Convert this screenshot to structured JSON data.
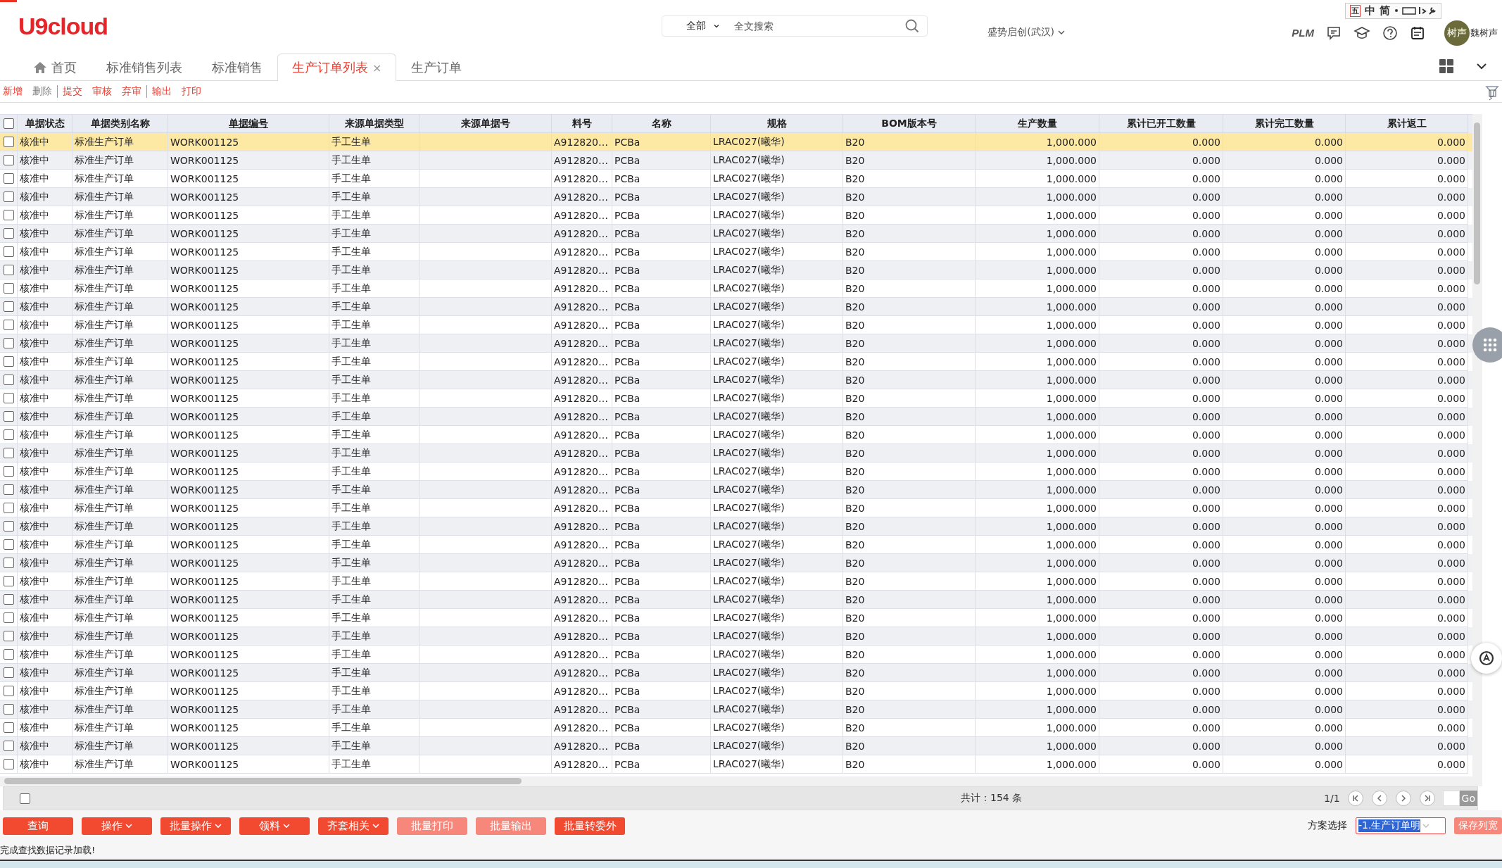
{
  "header": {
    "logo": "U9cloud",
    "search": {
      "scope": "全部",
      "placeholder": "全文搜索"
    },
    "company": "盛势启创(武汉)",
    "ime": [
      "五",
      "中",
      "简"
    ],
    "plm": "PLM",
    "avatar": "树声",
    "user": "魏树声"
  },
  "tabs": [
    {
      "label": "首页",
      "kind": "home",
      "selected": false,
      "closable": false
    },
    {
      "label": "标准销售列表",
      "kind": "page",
      "selected": false,
      "closable": false
    },
    {
      "label": "标准销售",
      "kind": "page",
      "selected": false,
      "closable": false
    },
    {
      "label": "生产订单列表",
      "kind": "page",
      "selected": true,
      "closable": true
    },
    {
      "label": "生产订单",
      "kind": "page",
      "selected": false,
      "closable": false
    }
  ],
  "close_mark": "×",
  "toolbar": [
    {
      "label": "新增",
      "disabled": false,
      "separator_after": false
    },
    {
      "label": "删除",
      "disabled": true,
      "separator_after": true
    },
    {
      "label": "提交",
      "disabled": false,
      "separator_after": false
    },
    {
      "label": "审核",
      "disabled": false,
      "separator_after": false
    },
    {
      "label": "弃审",
      "disabled": false,
      "separator_after": true
    },
    {
      "label": "输出",
      "disabled": false,
      "separator_after": false
    },
    {
      "label": "打印",
      "disabled": false,
      "separator_after": false
    }
  ],
  "table": {
    "select_all_checked": false,
    "columns": [
      {
        "label": "单据状态",
        "underlined": false
      },
      {
        "label": "单据类别名称",
        "underlined": false
      },
      {
        "label": "单据编号",
        "underlined": true
      },
      {
        "label": "来源单据类型",
        "underlined": false
      },
      {
        "label": "来源单据号",
        "underlined": false
      },
      {
        "label": "料号",
        "underlined": false
      },
      {
        "label": "名称",
        "underlined": false
      },
      {
        "label": "规格",
        "underlined": false
      },
      {
        "label": "BOM版本号",
        "underlined": false
      },
      {
        "label": "生产数量",
        "underlined": false
      },
      {
        "label": "累计已开工数量",
        "underlined": false
      },
      {
        "label": "累计完工数量",
        "underlined": false
      },
      {
        "label": "累计返工",
        "underlined": false
      }
    ],
    "rows": [
      {
        "selected": true,
        "checked": false,
        "cells": [
          "核准中",
          "标准生产订单",
          "WORK001125",
          "手工生单",
          null,
          "A912820…",
          "PCBa",
          "LRAC027(曦华)",
          "B20",
          "1,000.000",
          "0.000",
          "0.000",
          "0.000"
        ]
      },
      {
        "selected": false,
        "checked": false,
        "cells": [
          "核准中",
          "标准生产订单",
          "WORK001125",
          "手工生单",
          null,
          "A912820…",
          "PCBa",
          "LRAC027(曦华)",
          "B20",
          "1,000.000",
          "0.000",
          "0.000",
          "0.000"
        ]
      },
      {
        "selected": false,
        "checked": false,
        "cells": [
          "核准中",
          "标准生产订单",
          "WORK001125",
          "手工生单",
          null,
          "A912820…",
          "PCBa",
          "LRAC027(曦华)",
          "B20",
          "1,000.000",
          "0.000",
          "0.000",
          "0.000"
        ]
      },
      {
        "selected": false,
        "checked": false,
        "cells": [
          "核准中",
          "标准生产订单",
          "WORK001125",
          "手工生单",
          null,
          "A912820…",
          "PCBa",
          "LRAC027(曦华)",
          "B20",
          "1,000.000",
          "0.000",
          "0.000",
          "0.000"
        ]
      },
      {
        "selected": false,
        "checked": false,
        "cells": [
          "核准中",
          "标准生产订单",
          "WORK001125",
          "手工生单",
          null,
          "A912820…",
          "PCBa",
          "LRAC027(曦华)",
          "B20",
          "1,000.000",
          "0.000",
          "0.000",
          "0.000"
        ]
      },
      {
        "selected": false,
        "checked": false,
        "cells": [
          "核准中",
          "标准生产订单",
          "WORK001125",
          "手工生单",
          null,
          "A912820…",
          "PCBa",
          "LRAC027(曦华)",
          "B20",
          "1,000.000",
          "0.000",
          "0.000",
          "0.000"
        ]
      },
      {
        "selected": false,
        "checked": false,
        "cells": [
          "核准中",
          "标准生产订单",
          "WORK001125",
          "手工生单",
          null,
          "A912820…",
          "PCBa",
          "LRAC027(曦华)",
          "B20",
          "1,000.000",
          "0.000",
          "0.000",
          "0.000"
        ]
      },
      {
        "selected": false,
        "checked": false,
        "cells": [
          "核准中",
          "标准生产订单",
          "WORK001125",
          "手工生单",
          null,
          "A912820…",
          "PCBa",
          "LRAC027(曦华)",
          "B20",
          "1,000.000",
          "0.000",
          "0.000",
          "0.000"
        ]
      },
      {
        "selected": false,
        "checked": false,
        "cells": [
          "核准中",
          "标准生产订单",
          "WORK001125",
          "手工生单",
          null,
          "A912820…",
          "PCBa",
          "LRAC027(曦华)",
          "B20",
          "1,000.000",
          "0.000",
          "0.000",
          "0.000"
        ]
      },
      {
        "selected": false,
        "checked": false,
        "cells": [
          "核准中",
          "标准生产订单",
          "WORK001125",
          "手工生单",
          null,
          "A912820…",
          "PCBa",
          "LRAC027(曦华)",
          "B20",
          "1,000.000",
          "0.000",
          "0.000",
          "0.000"
        ]
      },
      {
        "selected": false,
        "checked": false,
        "cells": [
          "核准中",
          "标准生产订单",
          "WORK001125",
          "手工生单",
          null,
          "A912820…",
          "PCBa",
          "LRAC027(曦华)",
          "B20",
          "1,000.000",
          "0.000",
          "0.000",
          "0.000"
        ]
      },
      {
        "selected": false,
        "checked": false,
        "cells": [
          "核准中",
          "标准生产订单",
          "WORK001125",
          "手工生单",
          null,
          "A912820…",
          "PCBa",
          "LRAC027(曦华)",
          "B20",
          "1,000.000",
          "0.000",
          "0.000",
          "0.000"
        ]
      },
      {
        "selected": false,
        "checked": false,
        "cells": [
          "核准中",
          "标准生产订单",
          "WORK001125",
          "手工生单",
          null,
          "A912820…",
          "PCBa",
          "LRAC027(曦华)",
          "B20",
          "1,000.000",
          "0.000",
          "0.000",
          "0.000"
        ]
      },
      {
        "selected": false,
        "checked": false,
        "cells": [
          "核准中",
          "标准生产订单",
          "WORK001125",
          "手工生单",
          null,
          "A912820…",
          "PCBa",
          "LRAC027(曦华)",
          "B20",
          "1,000.000",
          "0.000",
          "0.000",
          "0.000"
        ]
      },
      {
        "selected": false,
        "checked": false,
        "cells": [
          "核准中",
          "标准生产订单",
          "WORK001125",
          "手工生单",
          null,
          "A912820…",
          "PCBa",
          "LRAC027(曦华)",
          "B20",
          "1,000.000",
          "0.000",
          "0.000",
          "0.000"
        ]
      },
      {
        "selected": false,
        "checked": false,
        "cells": [
          "核准中",
          "标准生产订单",
          "WORK001125",
          "手工生单",
          null,
          "A912820…",
          "PCBa",
          "LRAC027(曦华)",
          "B20",
          "1,000.000",
          "0.000",
          "0.000",
          "0.000"
        ]
      },
      {
        "selected": false,
        "checked": false,
        "cells": [
          "核准中",
          "标准生产订单",
          "WORK001125",
          "手工生单",
          null,
          "A912820…",
          "PCBa",
          "LRAC027(曦华)",
          "B20",
          "1,000.000",
          "0.000",
          "0.000",
          "0.000"
        ]
      },
      {
        "selected": false,
        "checked": false,
        "cells": [
          "核准中",
          "标准生产订单",
          "WORK001125",
          "手工生单",
          null,
          "A912820…",
          "PCBa",
          "LRAC027(曦华)",
          "B20",
          "1,000.000",
          "0.000",
          "0.000",
          "0.000"
        ]
      },
      {
        "selected": false,
        "checked": false,
        "cells": [
          "核准中",
          "标准生产订单",
          "WORK001125",
          "手工生单",
          null,
          "A912820…",
          "PCBa",
          "LRAC027(曦华)",
          "B20",
          "1,000.000",
          "0.000",
          "0.000",
          "0.000"
        ]
      },
      {
        "selected": false,
        "checked": false,
        "cells": [
          "核准中",
          "标准生产订单",
          "WORK001125",
          "手工生单",
          null,
          "A912820…",
          "PCBa",
          "LRAC027(曦华)",
          "B20",
          "1,000.000",
          "0.000",
          "0.000",
          "0.000"
        ]
      },
      {
        "selected": false,
        "checked": false,
        "cells": [
          "核准中",
          "标准生产订单",
          "WORK001125",
          "手工生单",
          null,
          "A912820…",
          "PCBa",
          "LRAC027(曦华)",
          "B20",
          "1,000.000",
          "0.000",
          "0.000",
          "0.000"
        ]
      },
      {
        "selected": false,
        "checked": false,
        "cells": [
          "核准中",
          "标准生产订单",
          "WORK001125",
          "手工生单",
          null,
          "A912820…",
          "PCBa",
          "LRAC027(曦华)",
          "B20",
          "1,000.000",
          "0.000",
          "0.000",
          "0.000"
        ]
      },
      {
        "selected": false,
        "checked": false,
        "cells": [
          "核准中",
          "标准生产订单",
          "WORK001125",
          "手工生单",
          null,
          "A912820…",
          "PCBa",
          "LRAC027(曦华)",
          "B20",
          "1,000.000",
          "0.000",
          "0.000",
          "0.000"
        ]
      },
      {
        "selected": false,
        "checked": false,
        "cells": [
          "核准中",
          "标准生产订单",
          "WORK001125",
          "手工生单",
          null,
          "A912820…",
          "PCBa",
          "LRAC027(曦华)",
          "B20",
          "1,000.000",
          "0.000",
          "0.000",
          "0.000"
        ]
      },
      {
        "selected": false,
        "checked": false,
        "cells": [
          "核准中",
          "标准生产订单",
          "WORK001125",
          "手工生单",
          null,
          "A912820…",
          "PCBa",
          "LRAC027(曦华)",
          "B20",
          "1,000.000",
          "0.000",
          "0.000",
          "0.000"
        ]
      },
      {
        "selected": false,
        "checked": false,
        "cells": [
          "核准中",
          "标准生产订单",
          "WORK001125",
          "手工生单",
          null,
          "A912820…",
          "PCBa",
          "LRAC027(曦华)",
          "B20",
          "1,000.000",
          "0.000",
          "0.000",
          "0.000"
        ]
      },
      {
        "selected": false,
        "checked": false,
        "cells": [
          "核准中",
          "标准生产订单",
          "WORK001125",
          "手工生单",
          null,
          "A912820…",
          "PCBa",
          "LRAC027(曦华)",
          "B20",
          "1,000.000",
          "0.000",
          "0.000",
          "0.000"
        ]
      },
      {
        "selected": false,
        "checked": false,
        "cells": [
          "核准中",
          "标准生产订单",
          "WORK001125",
          "手工生单",
          null,
          "A912820…",
          "PCBa",
          "LRAC027(曦华)",
          "B20",
          "1,000.000",
          "0.000",
          "0.000",
          "0.000"
        ]
      },
      {
        "selected": false,
        "checked": false,
        "cells": [
          "核准中",
          "标准生产订单",
          "WORK001125",
          "手工生单",
          null,
          "A912820…",
          "PCBa",
          "LRAC027(曦华)",
          "B20",
          "1,000.000",
          "0.000",
          "0.000",
          "0.000"
        ]
      },
      {
        "selected": false,
        "checked": false,
        "cells": [
          "核准中",
          "标准生产订单",
          "WORK001125",
          "手工生单",
          null,
          "A912820…",
          "PCBa",
          "LRAC027(曦华)",
          "B20",
          "1,000.000",
          "0.000",
          "0.000",
          "0.000"
        ]
      },
      {
        "selected": false,
        "checked": false,
        "cells": [
          "核准中",
          "标准生产订单",
          "WORK001125",
          "手工生单",
          null,
          "A912820…",
          "PCBa",
          "LRAC027(曦华)",
          "B20",
          "1,000.000",
          "0.000",
          "0.000",
          "0.000"
        ]
      },
      {
        "selected": false,
        "checked": false,
        "cells": [
          "核准中",
          "标准生产订单",
          "WORK001125",
          "手工生单",
          null,
          "A912820…",
          "PCBa",
          "LRAC027(曦华)",
          "B20",
          "1,000.000",
          "0.000",
          "0.000",
          "0.000"
        ]
      },
      {
        "selected": false,
        "checked": false,
        "cells": [
          "核准中",
          "标准生产订单",
          "WORK001125",
          "手工生单",
          null,
          "A912820…",
          "PCBa",
          "LRAC027(曦华)",
          "B20",
          "1,000.000",
          "0.000",
          "0.000",
          "0.000"
        ]
      },
      {
        "selected": false,
        "checked": false,
        "cells": [
          "核准中",
          "标准生产订单",
          "WORK001125",
          "手工生单",
          null,
          "A912820…",
          "PCBa",
          "LRAC027(曦华)",
          "B20",
          "1,000.000",
          "0.000",
          "0.000",
          "0.000"
        ]
      },
      {
        "selected": false,
        "checked": false,
        "cells": [
          "核准中",
          "标准生产订单",
          "WORK001125",
          "手工生单",
          null,
          "A912820…",
          "PCBa",
          "LRAC027(曦华)",
          "B20",
          "1,000.000",
          "0.000",
          "0.000",
          "0.000"
        ]
      }
    ]
  },
  "footer": {
    "select_all_checked": false,
    "total": "共计：154 条",
    "page": "1/1",
    "go": "Go"
  },
  "actions": [
    {
      "label": "查询",
      "dropdown": false,
      "disabled": false
    },
    {
      "label": "操作",
      "dropdown": true,
      "disabled": false
    },
    {
      "label": "批量操作",
      "dropdown": true,
      "disabled": false
    },
    {
      "label": "领料",
      "dropdown": true,
      "disabled": false
    },
    {
      "label": "齐套相关",
      "dropdown": true,
      "disabled": false
    },
    {
      "label": "批量打印",
      "dropdown": false,
      "disabled": true
    },
    {
      "label": "批量输出",
      "dropdown": false,
      "disabled": true
    },
    {
      "label": "批量转委外",
      "dropdown": false,
      "disabled": false
    }
  ],
  "scheme": {
    "label": "方案选择",
    "value": "-1.生产订单明",
    "save": "保存列宽"
  },
  "status": "完成查找数据记录加载!"
}
